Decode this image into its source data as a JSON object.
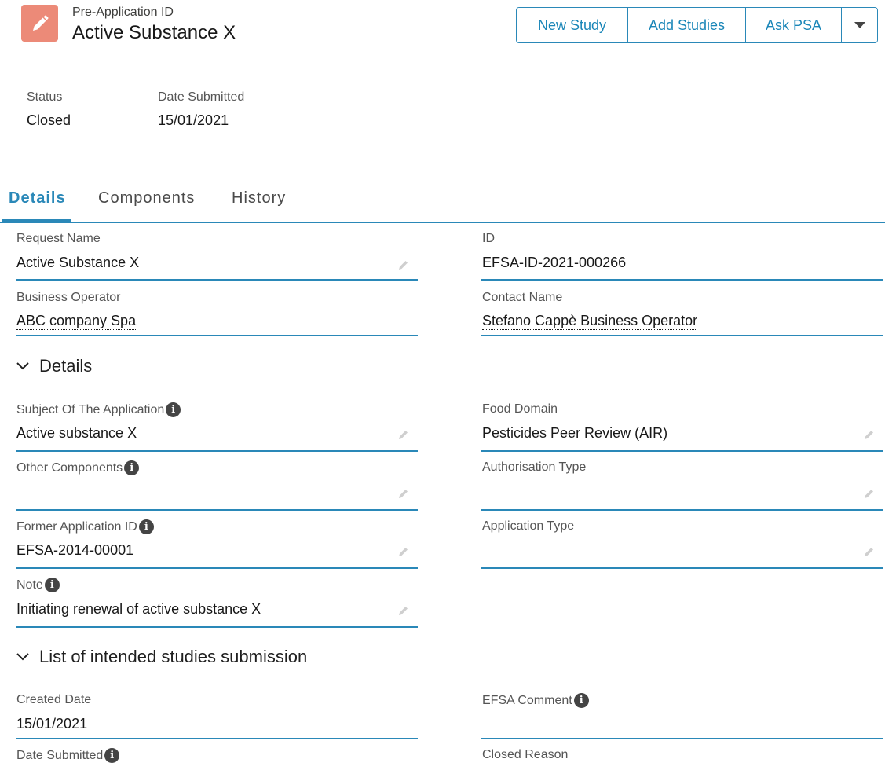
{
  "header": {
    "object_label": "Pre-Application ID",
    "title": "Active Substance X",
    "icon": "pencil-icon",
    "icon_color": "#ec8a78"
  },
  "actions": {
    "new_study": "New Study",
    "add_studies": "Add Studies",
    "ask_psa": "Ask PSA",
    "more_icon": "caret-down-icon"
  },
  "highlights": {
    "status_label": "Status",
    "status_value": "Closed",
    "date_label": "Date Submitted",
    "date_value": "15/01/2021"
  },
  "tabs": {
    "details": "Details",
    "components": "Components",
    "history": "History",
    "active": "Details"
  },
  "fields": {
    "request_name": {
      "label": "Request Name",
      "value": "Active Substance X"
    },
    "id": {
      "label": "ID",
      "value": "EFSA-ID-2021-000266"
    },
    "business_operator": {
      "label": "Business Operator",
      "value": "ABC company Spa"
    },
    "contact_name": {
      "label": "Contact Name",
      "value": "Stefano Cappè Business Operator"
    }
  },
  "sections": {
    "details": {
      "title": "Details",
      "subject": {
        "label": "Subject Of The Application",
        "value": "Active substance X"
      },
      "food_domain": {
        "label": "Food Domain",
        "value": "Pesticides Peer Review (AIR)"
      },
      "other_components": {
        "label": "Other Components",
        "value": ""
      },
      "authorisation_type": {
        "label": "Authorisation Type",
        "value": ""
      },
      "former_application_id": {
        "label": "Former Application ID",
        "value": "EFSA-2014-00001"
      },
      "application_type": {
        "label": "Application Type",
        "value": ""
      },
      "note": {
        "label": "Note",
        "value": "Initiating renewal of active substance X"
      }
    },
    "studies": {
      "title": "List of intended studies submission",
      "created_date": {
        "label": "Created Date",
        "value": "15/01/2021"
      },
      "efsa_comment": {
        "label": "EFSA Comment",
        "value": ""
      },
      "date_submitted": {
        "label": "Date Submitted"
      },
      "closed_reason": {
        "label": "Closed Reason"
      }
    }
  },
  "colors": {
    "accent": "#2a88b8",
    "text": "#181818",
    "label": "#555555"
  }
}
